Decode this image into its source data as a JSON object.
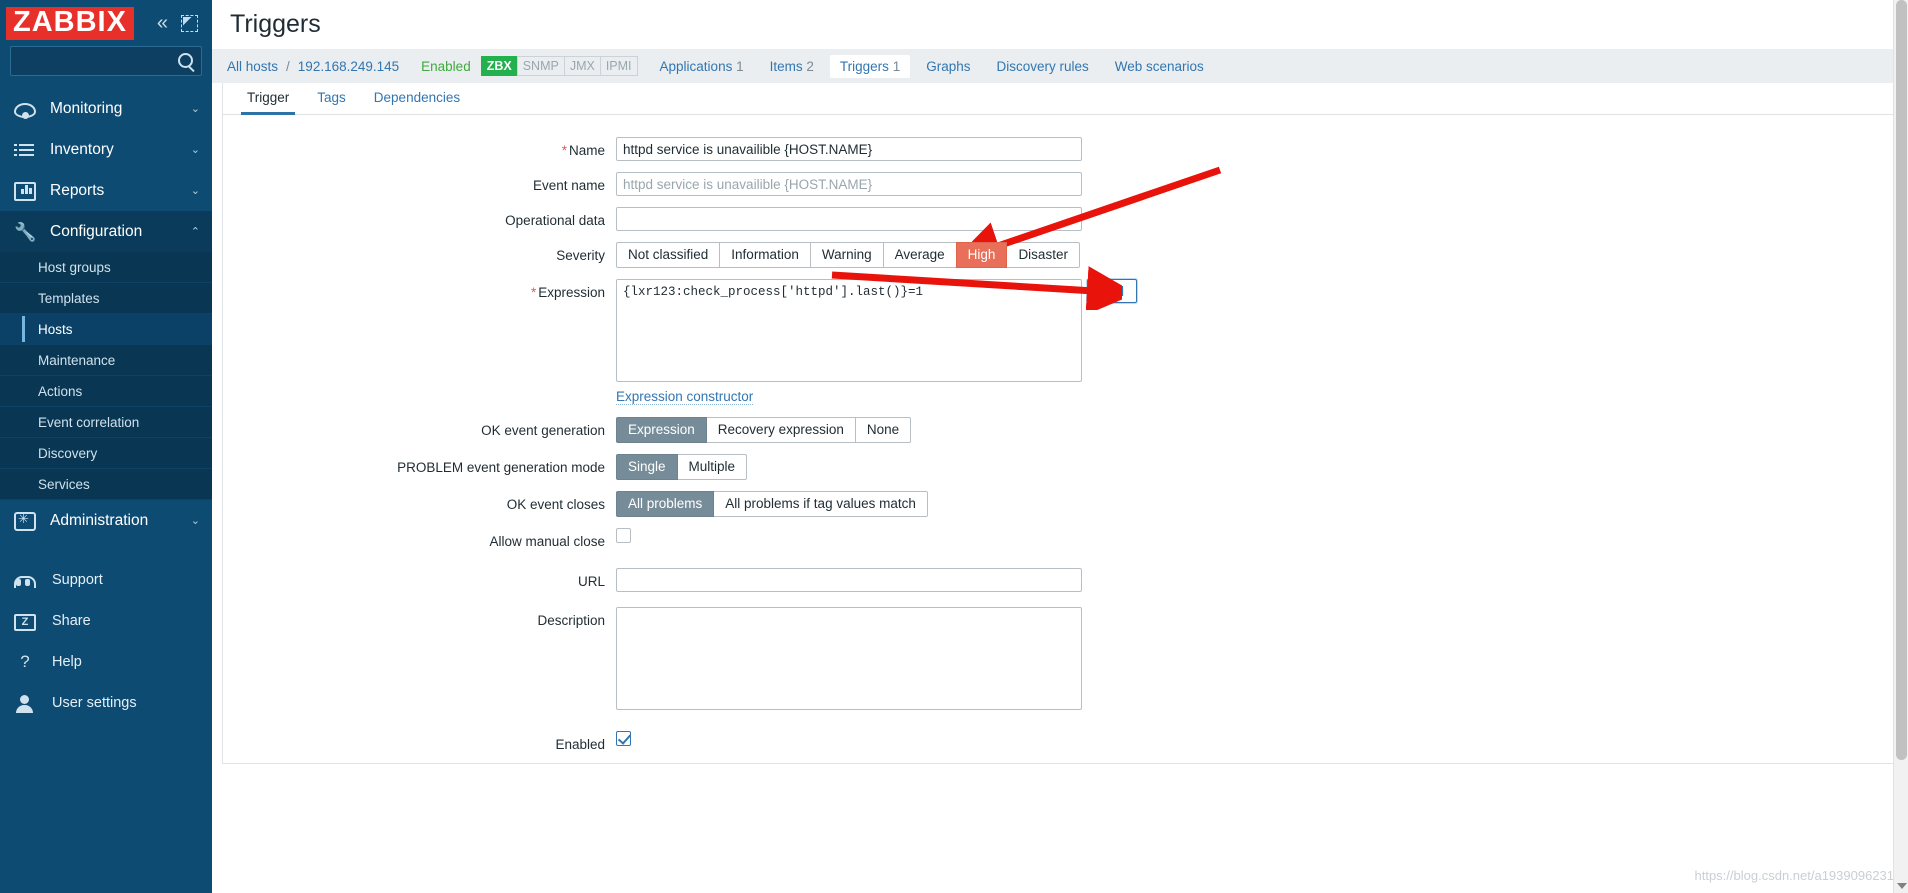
{
  "brand": {
    "logo": "ZABBIX",
    "collapse_icon": "«",
    "expand_icon": "expand-view-icon"
  },
  "search": {
    "value": "",
    "placeholder": ""
  },
  "sidebar": {
    "main_items": [
      {
        "label": "Monitoring",
        "icon": "eye-icon",
        "chevron": "⌄",
        "active": false
      },
      {
        "label": "Inventory",
        "icon": "list-icon",
        "chevron": "⌄",
        "active": false
      },
      {
        "label": "Reports",
        "icon": "bar-chart-icon",
        "chevron": "⌄",
        "active": false
      },
      {
        "label": "Configuration",
        "icon": "wrench-icon",
        "chevron": "⌃",
        "active": true
      }
    ],
    "config_subitems": [
      {
        "label": "Host groups",
        "active": false
      },
      {
        "label": "Templates",
        "active": false
      },
      {
        "label": "Hosts",
        "active": true
      },
      {
        "label": "Maintenance",
        "active": false
      },
      {
        "label": "Actions",
        "active": false
      },
      {
        "label": "Event correlation",
        "active": false
      },
      {
        "label": "Discovery",
        "active": false
      },
      {
        "label": "Services",
        "active": false
      }
    ],
    "administration": {
      "label": "Administration",
      "icon": "gear-icon",
      "chevron": "⌄"
    },
    "bottom_items": [
      {
        "label": "Support",
        "icon": "headset-icon"
      },
      {
        "label": "Share",
        "icon": "zabbix-share-icon",
        "glyph": "Z"
      },
      {
        "label": "Help",
        "icon": "question-icon",
        "glyph": "?"
      },
      {
        "label": "User settings",
        "icon": "user-icon"
      }
    ]
  },
  "header": {
    "title": "Triggers"
  },
  "breadcrumb": {
    "all_hosts": "All hosts",
    "separator": "/",
    "host": "192.168.249.145",
    "status": "Enabled",
    "interface_tags": [
      {
        "label": "ZBX",
        "active": true
      },
      {
        "label": "SNMP",
        "active": false
      },
      {
        "label": "JMX",
        "active": false
      },
      {
        "label": "IPMI",
        "active": false
      }
    ],
    "tabs": [
      {
        "label": "Applications",
        "count": "1",
        "active": false
      },
      {
        "label": "Items",
        "count": "2",
        "active": false
      },
      {
        "label": "Triggers",
        "count": "1",
        "active": true
      },
      {
        "label": "Graphs",
        "count": "",
        "active": false
      },
      {
        "label": "Discovery rules",
        "count": "",
        "active": false
      },
      {
        "label": "Web scenarios",
        "count": "",
        "active": false
      }
    ]
  },
  "tabs": [
    {
      "label": "Trigger",
      "active": true
    },
    {
      "label": "Tags",
      "active": false
    },
    {
      "label": "Dependencies",
      "active": false
    }
  ],
  "form": {
    "name": {
      "label": "Name",
      "required": true,
      "value": "httpd service is unavailible {HOST.NAME}"
    },
    "event_name": {
      "label": "Event name",
      "value": "",
      "placeholder": "httpd service is unavailible {HOST.NAME}"
    },
    "operational_data": {
      "label": "Operational data",
      "value": "",
      "placeholder": ""
    },
    "severity": {
      "label": "Severity",
      "options": [
        "Not classified",
        "Information",
        "Warning",
        "Average",
        "High",
        "Disaster"
      ],
      "selected": "High",
      "selected_color": "#e8705a"
    },
    "expression": {
      "label": "Expression",
      "required": true,
      "value": "{lxr123:check_process['httpd'].last()}=1",
      "add_button": "Add",
      "constructor_link": "Expression constructor"
    },
    "ok_event_generation": {
      "label": "OK event generation",
      "options": [
        "Expression",
        "Recovery expression",
        "None"
      ],
      "selected": "Expression"
    },
    "problem_event_generation_mode": {
      "label": "PROBLEM event generation mode",
      "options": [
        "Single",
        "Multiple"
      ],
      "selected": "Single"
    },
    "ok_event_closes": {
      "label": "OK event closes",
      "options": [
        "All problems",
        "All problems if tag values match"
      ],
      "selected": "All problems"
    },
    "allow_manual_close": {
      "label": "Allow manual close",
      "checked": false
    },
    "url": {
      "label": "URL",
      "value": "",
      "placeholder": ""
    },
    "description": {
      "label": "Description",
      "value": "",
      "placeholder": ""
    },
    "enabled": {
      "label": "Enabled",
      "checked": true
    }
  },
  "watermark": "https://blog.csdn.net/a1939096231"
}
